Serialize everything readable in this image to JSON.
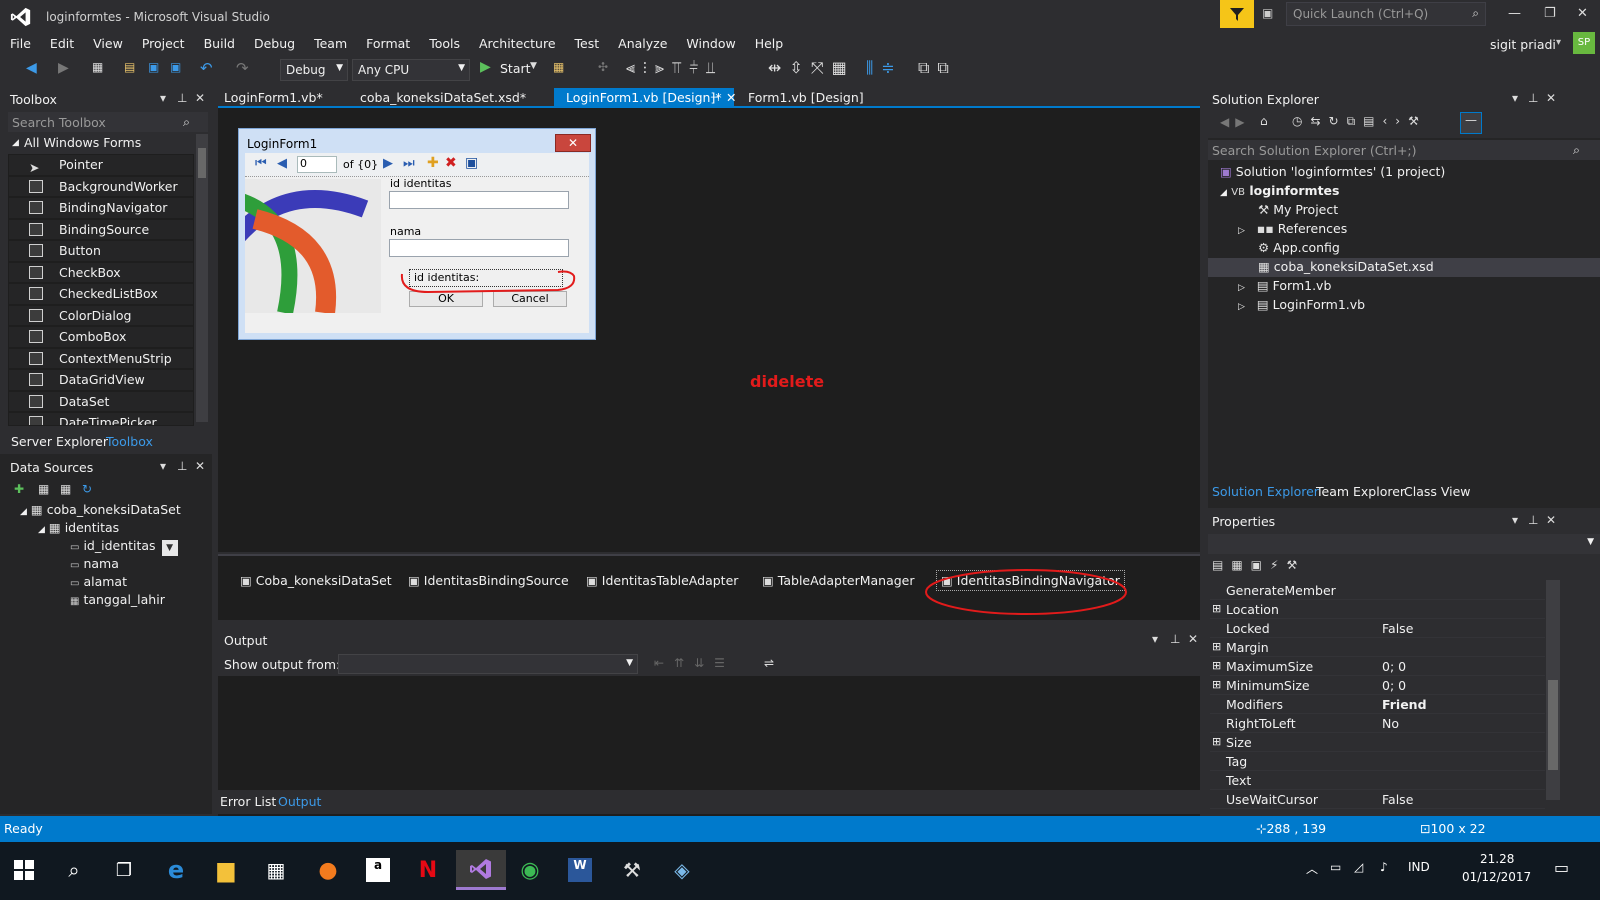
{
  "window": {
    "title": "loginformtes - Microsoft Visual Studio",
    "quick_launch": "Quick Launch (Ctrl+Q)",
    "user": "sigit priadi",
    "avatar": "SP"
  },
  "menu": [
    "File",
    "Edit",
    "View",
    "Project",
    "Build",
    "Debug",
    "Team",
    "Format",
    "Tools",
    "Architecture",
    "Test",
    "Analyze",
    "Window",
    "Help"
  ],
  "toolbar": {
    "config": "Debug",
    "platform": "Any CPU",
    "start": "Start"
  },
  "toolbox": {
    "title": "Toolbox",
    "search_placeholder": "Search Toolbox",
    "group": "All Windows Forms",
    "items": [
      "Pointer",
      "BackgroundWorker",
      "BindingNavigator",
      "BindingSource",
      "Button",
      "CheckBox",
      "CheckedListBox",
      "ColorDialog",
      "ComboBox",
      "ContextMenuStrip",
      "DataGridView",
      "DataSet",
      "DateTimePicker"
    ],
    "tab_server": "Server Explorer",
    "tab_toolbox": "Toolbox"
  },
  "datasources": {
    "title": "Data Sources",
    "dataset": "coba_koneksiDataSet",
    "table": "identitas",
    "fields": [
      "id_identitas",
      "nama",
      "alamat",
      "tanggal_lahir"
    ]
  },
  "doctabs": [
    "LoginForm1.vb*",
    "coba_koneksiDataSet.xsd*",
    "LoginForm1.vb [Design]*",
    "Form1.vb [Design]"
  ],
  "form": {
    "title": "LoginForm1",
    "nav_position": "0",
    "nav_count": "of {0}",
    "label_id": "id identitas",
    "label_nama": "nama",
    "label_id2": "id identitas:",
    "ok": "OK",
    "cancel": "Cancel"
  },
  "annotation": "didelete",
  "tray": [
    "Coba_koneksiDataSet",
    "IdentitasBindingSource",
    "IdentitasTableAdapter",
    "TableAdapterManager",
    "IdentitasBindingNavigator"
  ],
  "output": {
    "title": "Output",
    "show_from": "Show output from:",
    "tab_error": "Error List",
    "tab_output": "Output"
  },
  "solution": {
    "title": "Solution Explorer",
    "search_placeholder": "Search Solution Explorer (Ctrl+;)",
    "root": "Solution 'loginformtes' (1 project)",
    "project": "loginformtes",
    "items": [
      "My Project",
      "References",
      "App.config",
      "coba_koneksiDataSet.xsd",
      "Form1.vb",
      "LoginForm1.vb"
    ],
    "tabs": [
      "Solution Explorer",
      "Team Explorer",
      "Class View"
    ]
  },
  "properties": {
    "title": "Properties",
    "rows": [
      [
        "GenerateMember",
        ""
      ],
      [
        "Location",
        ""
      ],
      [
        "Locked",
        "False"
      ],
      [
        "Margin",
        ""
      ],
      [
        "MaximumSize",
        "0; 0"
      ],
      [
        "MinimumSize",
        "0; 0"
      ],
      [
        "Modifiers",
        "Friend"
      ],
      [
        "RightToLeft",
        "No"
      ],
      [
        "Size",
        ""
      ],
      [
        "Tag",
        ""
      ],
      [
        "Text",
        ""
      ],
      [
        "UseWaitCursor",
        "False"
      ]
    ],
    "expandable": [
      1,
      3,
      4,
      5,
      8
    ]
  },
  "status": {
    "text": "Ready",
    "position": "288 , 139",
    "size": "100 x 22"
  },
  "tray_clock": {
    "lang": "IND",
    "time": "21.28",
    "date": "01/12/2017"
  },
  "colors": {
    "accent": "#007acc",
    "annotation": "#e21b1b",
    "vs_purple": "#68217a"
  }
}
